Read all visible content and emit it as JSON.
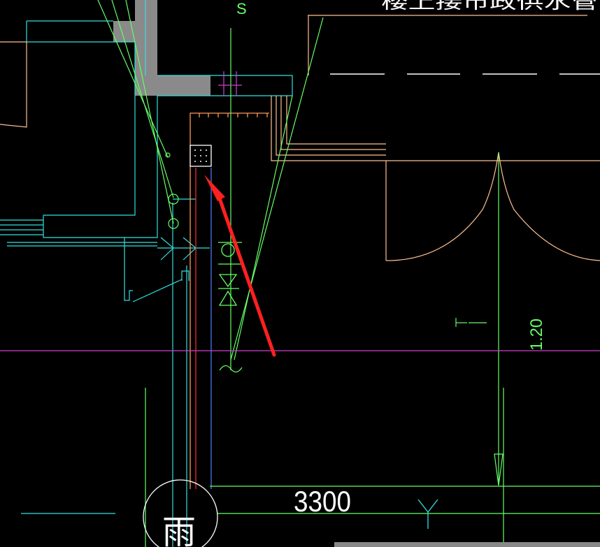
{
  "drawing": {
    "top_note": "楼上接市政供水管",
    "dimension_value": "3300",
    "elevation_label": "1.20",
    "room_label": "雨",
    "level_mark": "T"
  },
  "colors": {
    "background": "#000000",
    "green": "#66ff66",
    "cyan": "#33e0e0",
    "orange": "#ff9a55",
    "peach": "#ffc090",
    "magenta": "#d040d0",
    "blue": "#5080ff",
    "red": "#ff2020",
    "gray": "#8a8a8a",
    "white": "#ffffff"
  }
}
